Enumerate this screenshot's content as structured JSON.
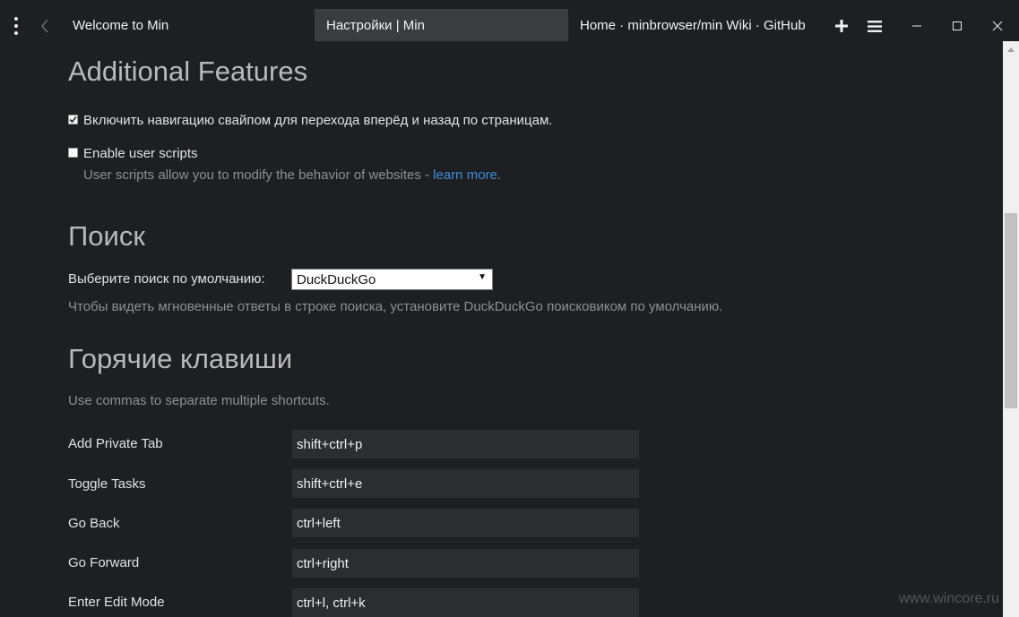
{
  "tabs": [
    {
      "title": "Welcome to Min",
      "active": false
    },
    {
      "title": "Настройки | Min",
      "active": true
    },
    {
      "title": "Home · minbrowser/min Wiki · GitHub",
      "active": false
    }
  ],
  "toolbar": {
    "menu_icon": "vertical-dots-icon",
    "back_icon": "chevron-left-icon",
    "new_tab_icon": "plus-icon",
    "tasks_icon": "hamburger-icon"
  },
  "additional_features": {
    "heading": "Additional Features",
    "swipe_navigation": {
      "label": "Включить навигацию свайпом для перехода вперёд и назад по страницам.",
      "checked": true
    },
    "user_scripts": {
      "label": "Enable user scripts",
      "checked": false,
      "description": "User scripts allow you to modify the behavior of websites - ",
      "link": "learn more",
      "suffix": "."
    }
  },
  "search": {
    "heading": "Поиск",
    "label": "Выберите поиск по умолчанию:",
    "selected": "DuckDuckGo",
    "hint": "Чтобы видеть мгновенные ответы в строке поиска, установите DuckDuckGo поисковиком по умолчанию."
  },
  "hotkeys": {
    "heading": "Горячие клавиши",
    "hint": "Use commas to separate multiple shortcuts.",
    "rows": [
      {
        "label": "Add Private Tab",
        "value": "shift+ctrl+p"
      },
      {
        "label": "Toggle Tasks",
        "value": "shift+ctrl+e"
      },
      {
        "label": "Go Back",
        "value": "ctrl+left"
      },
      {
        "label": "Go Forward",
        "value": "ctrl+right"
      },
      {
        "label": "Enter Edit Mode",
        "value": "ctrl+l, ctrl+k"
      }
    ]
  },
  "watermark": "www.wincore.ru",
  "colors": {
    "background": "#1e1f22",
    "active_tab": "#3a3c40",
    "input_bg": "#2c2d31",
    "link": "#3e8fd8",
    "heading": "#b9b9b9"
  }
}
